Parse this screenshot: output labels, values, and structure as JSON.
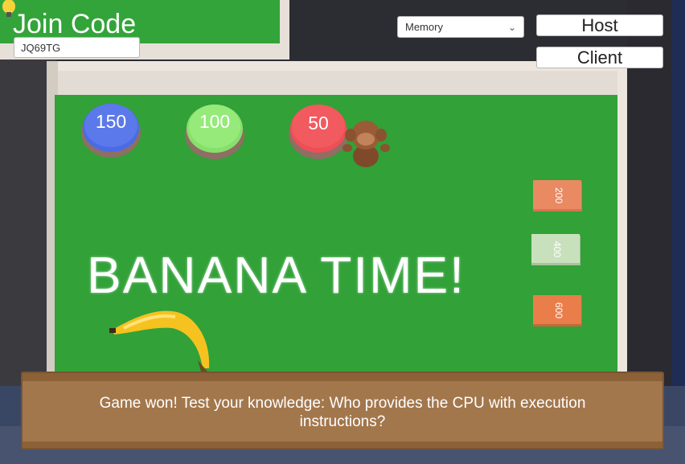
{
  "ui": {
    "join_title": "Join Code",
    "join_code_value": "JQ69TG",
    "mode_select": "Memory",
    "host_label": "Host",
    "client_label": "Client"
  },
  "bets": [
    {
      "label": "150",
      "color": "#4a6be6"
    },
    {
      "label": "100",
      "color": "#86e06b"
    },
    {
      "label": "50",
      "color": "#ec4f55"
    }
  ],
  "cards": [
    {
      "label": "200",
      "color": "#e98a63"
    },
    {
      "label": "400",
      "color": "#c9e0bd"
    },
    {
      "label": "600",
      "color": "#ea7e4b"
    }
  ],
  "board": {
    "headline": "BANANA TIME!"
  },
  "dialog": {
    "message": "Game won! Test your knowledge: Who provides the CPU with execution instructions?"
  },
  "colors": {
    "board_green": "#31a138",
    "dialog_brown": "#a3774c"
  }
}
